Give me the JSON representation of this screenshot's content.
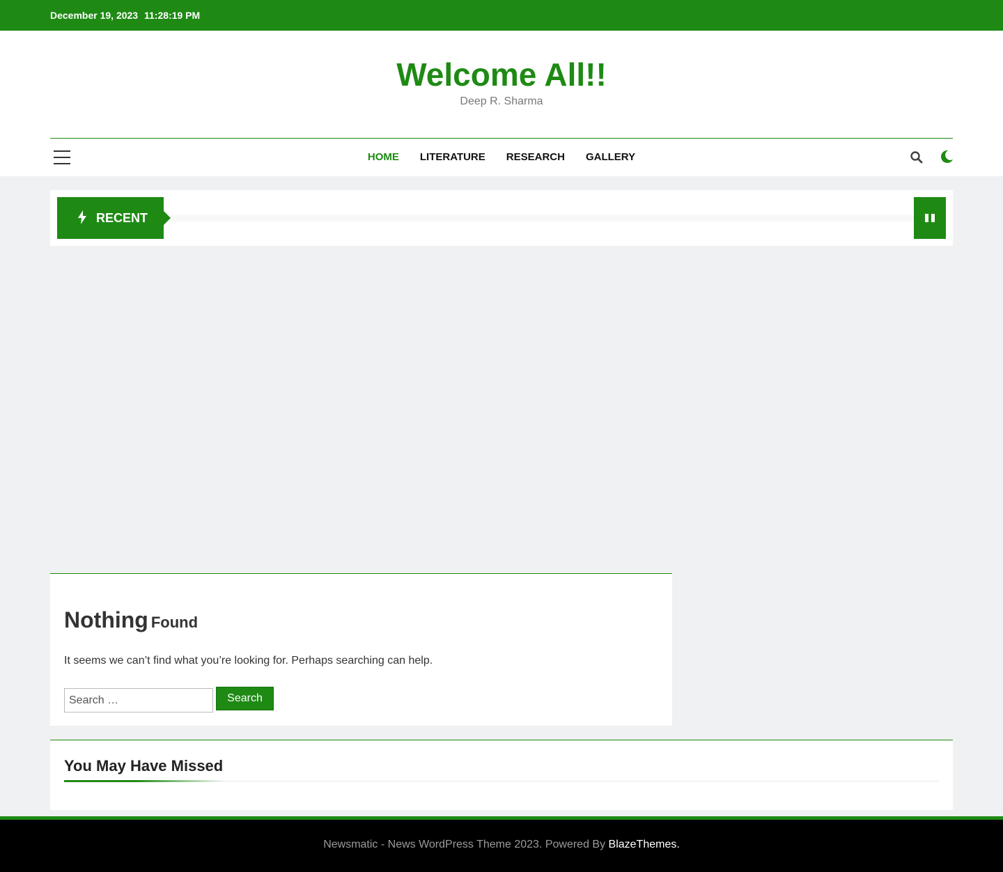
{
  "topbar": {
    "date": "December 19, 2023",
    "time": "11:28:19 PM"
  },
  "site": {
    "title": "Welcome All!!",
    "description": "Deep R. Sharma"
  },
  "nav": {
    "items": [
      {
        "label": "HOME"
      },
      {
        "label": "LITERATURE"
      },
      {
        "label": "RESEARCH"
      },
      {
        "label": "GALLERY"
      }
    ],
    "active": "HOME",
    "icons": [
      "hamburger-menu-icon",
      "search-icon",
      "moon-icon"
    ]
  },
  "ticker": {
    "label": "RECENT",
    "icon": "bolt-icon",
    "control": "pause-icon"
  },
  "main": {
    "heading_big": "Nothing",
    "heading_small": "Found",
    "message": "It seems we can’t find what you’re looking for. Perhaps searching can help.",
    "search_placeholder": "Search …",
    "search_button": "Search"
  },
  "missed": {
    "title": "You May Have Missed"
  },
  "footer": {
    "text": "Newsmatic - News WordPress Theme 2023. Powered By",
    "link": "BlazeThemes.",
    "link_separator": " "
  },
  "colors": {
    "accent": "#1e8a14",
    "footer_bg": "#000000",
    "page_bg": "#f0f1f2"
  }
}
